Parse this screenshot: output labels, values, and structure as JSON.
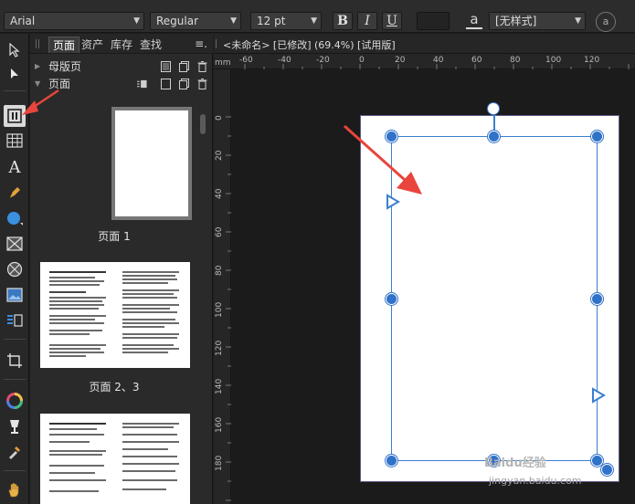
{
  "toolbar": {
    "font_family": "Arial",
    "font_style": "Regular",
    "font_size": "12 pt",
    "bold_label": "B",
    "italic_label": "I",
    "underline_label": "U",
    "char_icon_label": "a",
    "style_value": "[无样式]",
    "right_icon_label": "a"
  },
  "panel": {
    "tabs": [
      "页面",
      "资产",
      "库存",
      "查找"
    ],
    "master_section": "母版页",
    "pages_section": "页面",
    "page_labels": [
      "页面 1",
      "页面 2、3"
    ]
  },
  "document": {
    "title": "<未命名> [已修改] (69.4%) [试用版]",
    "ruler_unit": "mm",
    "ruler_h_labels": [
      "-60",
      "-40",
      "-20",
      "0",
      "20",
      "40",
      "60",
      "80",
      "100",
      "120"
    ],
    "ruler_v_labels": [
      "0",
      "20",
      "40",
      "60",
      "80",
      "100",
      "120",
      "140",
      "160",
      "180"
    ]
  },
  "watermark": {
    "brand": "Baidu经验",
    "url": "jingyan.baidu.com"
  },
  "colors": {
    "accent": "#3072c8",
    "annotation_arrow": "#e8453c",
    "panel_bg": "#2a2a2a",
    "pasteboard": "#1b1b1b"
  },
  "tools": [
    "move-icon",
    "node-icon",
    "text-frame-icon",
    "table-icon",
    "artistic-text-icon",
    "pen-icon",
    "shape-icon",
    "picture-frame-icon",
    "ellipse-frame-icon",
    "image-icon",
    "placeholder-icon",
    "crop-icon",
    "color-wheel-icon",
    "fill-icon",
    "eyedropper-icon",
    "hand-icon"
  ]
}
